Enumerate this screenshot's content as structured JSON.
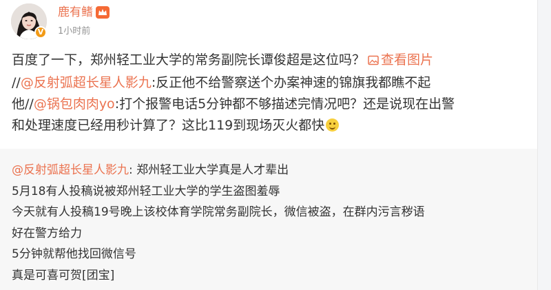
{
  "post": {
    "author": "鹿有鳍",
    "time": "1小时前",
    "text": {
      "line1_a": "百度了一下，郑州轻工业大学的常务副院长谭俊超是这位吗？",
      "view_image": "查看图片",
      "line2_prefix": "//",
      "mention1": "@反射弧超长星人影九",
      "line2_rest": ":反正他不给警察送个办案神速的锦旗我都瞧不起",
      "line3_a": "他//",
      "mention2": "@锅包肉肉yo",
      "line3_rest": ":打个报警电话5分钟都不够描述完情况吧？还是说现在出警",
      "line4": "和处理速度已经用秒计算了？这比119到现场灭火都快"
    }
  },
  "repost": {
    "mention": "@反射弧超长星人影九",
    "line1_rest": ": 郑州轻工业大学真是人才辈出",
    "lines": [
      "5月18有人投稿说被郑州轻工业大学的学生盗图羞辱",
      "今天就有人投稿19号晚上该校体育学院常务副院长，微信被盗，在群内污言秽语",
      "好在警方给力",
      "5分钟就帮他找回微信号",
      "真是可喜可贺[团宝]"
    ]
  },
  "icons": {
    "avatar": "user-avatar",
    "verify": "verified-badge-icon",
    "crown": "member-crown-icon",
    "image": "image-icon",
    "emoji": "smile-emoji-icon"
  },
  "colors": {
    "accent": "#eb7350",
    "text": "#333333",
    "muted": "#939393",
    "repost_bg": "#f7f7f7"
  }
}
